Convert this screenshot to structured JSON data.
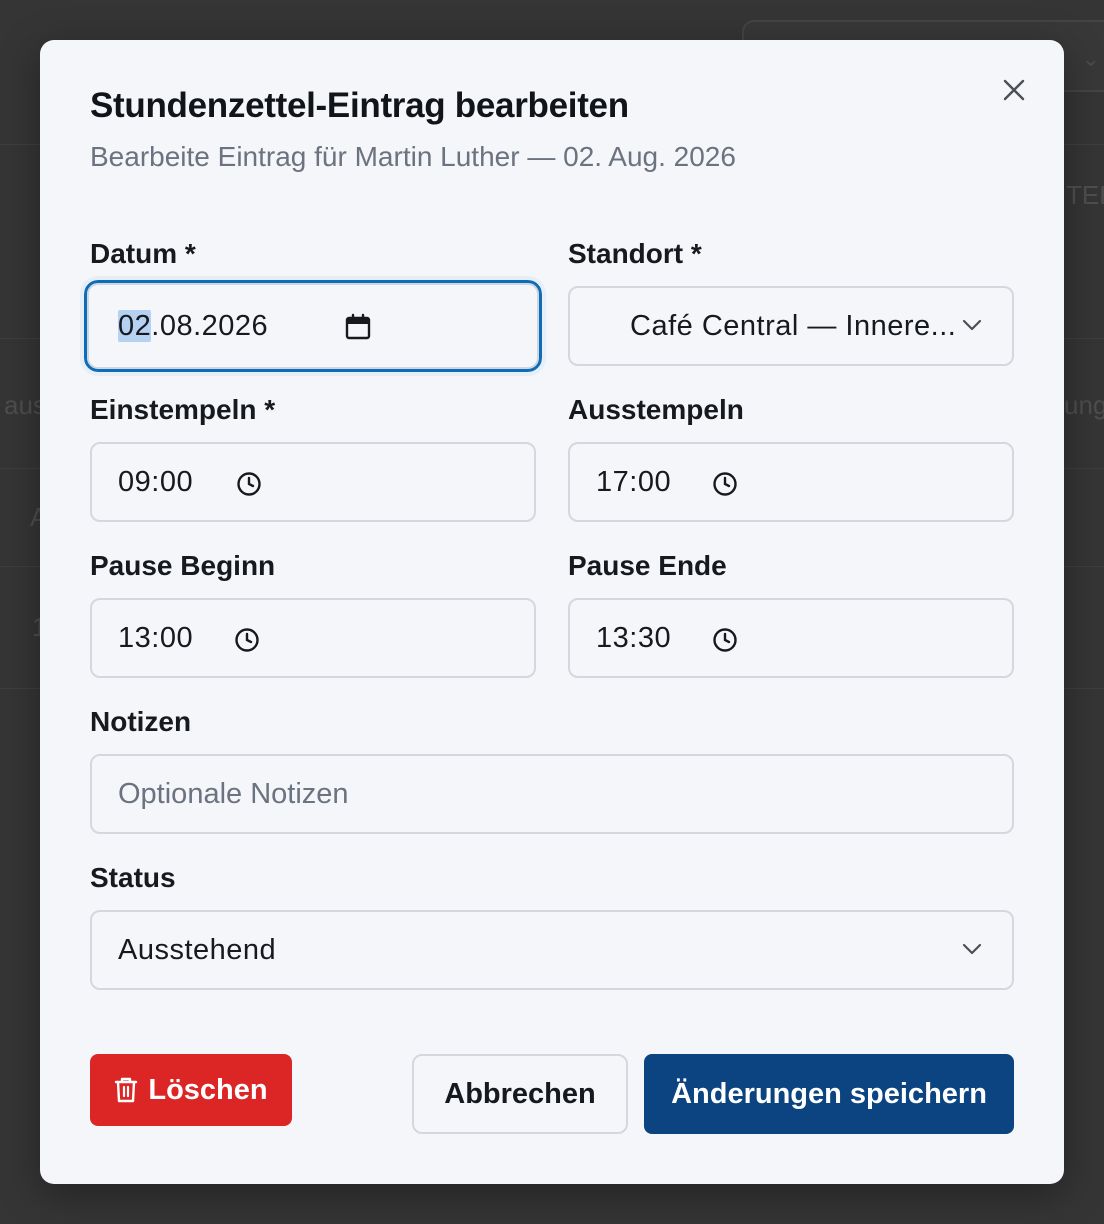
{
  "background": {
    "fragments": [
      "aus",
      "TER",
      "ungs",
      "A",
      "1"
    ]
  },
  "dialog": {
    "title": "Stundenzettel-Eintrag bearbeiten",
    "subtitle": "Bearbeite Eintrag für Martin Luther — 02. Aug. 2026",
    "close_icon": "close-icon",
    "fields": {
      "date": {
        "label": "Datum *",
        "day": "02",
        "rest": ".08.2026",
        "icon": "calendar-icon"
      },
      "location": {
        "label": "Standort *",
        "value": "Café Central — Innere...",
        "icon": "chevron-down-icon"
      },
      "clock_in": {
        "label": "Einstempeln *",
        "value": "09:00",
        "icon": "clock-icon"
      },
      "clock_out": {
        "label": "Ausstempeln",
        "value": "17:00",
        "icon": "clock-icon"
      },
      "break_start": {
        "label": "Pause Beginn",
        "value": "13:00",
        "icon": "clock-icon"
      },
      "break_end": {
        "label": "Pause Ende",
        "value": "13:30",
        "icon": "clock-icon"
      },
      "notes": {
        "label": "Notizen",
        "placeholder": "Optionale Notizen"
      },
      "status": {
        "label": "Status",
        "value": "Ausstehend",
        "icon": "chevron-down-icon"
      }
    },
    "buttons": {
      "delete": "Löschen",
      "cancel": "Abbrechen",
      "save": "Änderungen speichern"
    },
    "colors": {
      "delete": "#dc2626",
      "save": "#0b4480",
      "focus": "#0f6cb7"
    }
  }
}
